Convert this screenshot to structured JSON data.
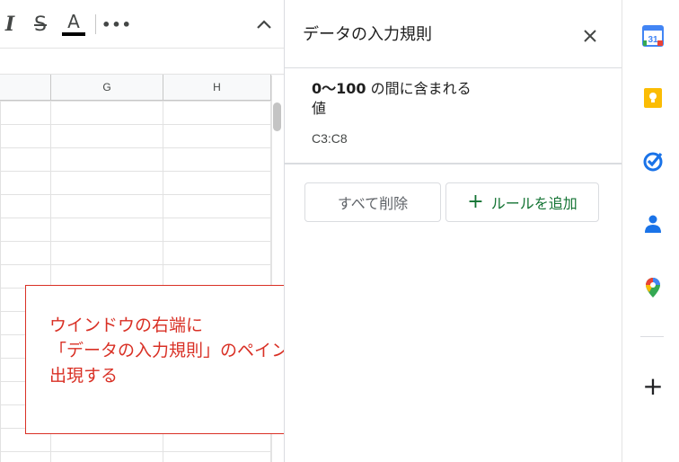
{
  "toolbar": {
    "italic_label": "I",
    "strike_label": "S",
    "text_color_label": "A",
    "more_label": "•••",
    "collapse_label": "^"
  },
  "sheet": {
    "columns": [
      "G",
      "H"
    ]
  },
  "pane": {
    "title": "データの入力規則",
    "close_label": "×",
    "rule": {
      "range_bold": "0〜100",
      "text_rest": " の間に含まれる値",
      "cells": "C3:C8"
    },
    "delete_all_label": "すべて削除",
    "add_rule_plus": "+",
    "add_rule_label": "ルールを追加"
  },
  "side_panel": {
    "icons": [
      "calendar-icon",
      "keep-icon",
      "tasks-icon",
      "contacts-icon",
      "maps-icon"
    ],
    "calendar_day": "31",
    "add_label": "+"
  },
  "annotation": {
    "text": "ウインドウの右端に\n「データの入力規則」のペインが\n出現する",
    "color": "#d93025"
  },
  "colors": {
    "accent_green": "#137333",
    "annotation_red": "#d93025"
  }
}
